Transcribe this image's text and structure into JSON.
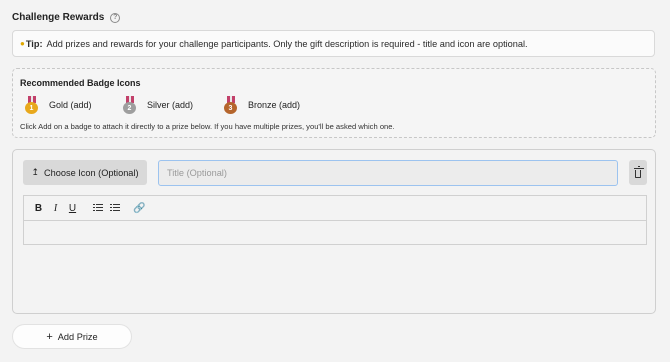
{
  "section": {
    "title": "Challenge Rewards",
    "help_icon": "?"
  },
  "tip": {
    "icon": "lightbulb-icon",
    "label": "Tip:",
    "text": "Add prizes and rewards for your challenge participants. Only the gift description is required - title and icon are optional."
  },
  "badges": {
    "title": "Recommended Badge Icons",
    "items": [
      {
        "label": "Gold (add)",
        "digit": "1",
        "color": "#e8a81c"
      },
      {
        "label": "Silver (add)",
        "digit": "2",
        "color": "#9e9e9e"
      },
      {
        "label": "Bronze (add)",
        "digit": "3",
        "color": "#b5652c"
      }
    ],
    "note": "Click Add on a badge to attach it directly to a prize below. If you have multiple prizes, you'll be asked which one."
  },
  "prize": {
    "choose_icon_label": "Choose Icon (Optional)",
    "title_placeholder": "Title (Optional)",
    "toolbar": {
      "bold": "B",
      "italic": "I",
      "underline": "U"
    }
  },
  "add_prize_label": "Add Prize",
  "colors": {
    "input_focus_border": "#9cc3ef",
    "background": "#f3f3f3"
  }
}
